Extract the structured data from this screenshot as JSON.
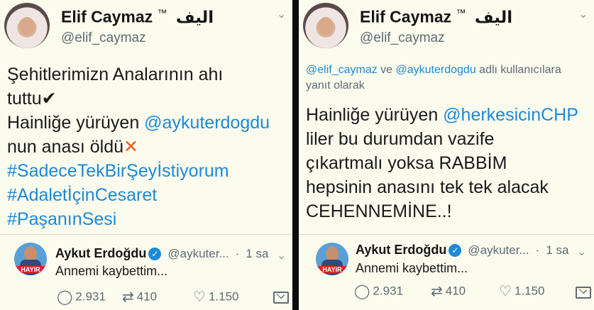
{
  "left": {
    "author": {
      "name": "Elif Caymaz",
      "tm": "™",
      "arabic": "اليف",
      "handle": "@elif_caymaz"
    },
    "lines": [
      {
        "text": "Şehitlerimizn Analarının ahı"
      },
      {
        "text": "tuttu",
        "suffix": "✔"
      },
      {
        "prefix": "Hainliğe yürüyen ",
        "mention": "@aykuterdogdu"
      },
      {
        "text": "nun anası öldü",
        "suffix": "✕"
      },
      {
        "hashtag": "#SadeceTekBirŞeyİstiyorum"
      },
      {
        "hashtag": "#AdaletİçinCesaret"
      },
      {
        "hashtag": "#PaşanınSesi"
      }
    ],
    "quote": {
      "name": "Aykut Erdoğdu",
      "verified": "✓",
      "handle": "@aykuter...",
      "dot": "·",
      "time": "1 sa",
      "text": "Annemi kaybettim...",
      "badge": "HAYIR"
    },
    "actions": {
      "replies": "2.931",
      "retweets": "410",
      "likes": "1.150"
    }
  },
  "right": {
    "author": {
      "name": "Elif Caymaz",
      "tm": "™",
      "arabic": "اليف",
      "handle": "@elif_caymaz"
    },
    "reply_to": {
      "mention1": "@elif_caymaz",
      "and": " ve ",
      "mention2": "@aykuterdogdu",
      "rest": " adlı kullanıcılara",
      "line2": "yanıt olarak"
    },
    "lines": [
      {
        "prefix": "Hainliğe yürüyen ",
        "mention": "@herkesicinCHP"
      },
      {
        "text": "liler bu durumdan vazife"
      },
      {
        "text": "çıkartmalı yoksa RABBİM"
      },
      {
        "text": "hepsinin anasını tek tek alacak"
      },
      {
        "text": "CEHENNEMİNE..!"
      }
    ],
    "quote": {
      "name": "Aykut Erdoğdu",
      "verified": "✓",
      "handle": "@aykuter...",
      "dot": "·",
      "time": "1 sa",
      "text": "Annemi kaybettim...",
      "badge": "HAYIR"
    },
    "actions": {
      "replies": "2.931",
      "retweets": "410",
      "likes": "1.150"
    }
  },
  "icons": {
    "reply": "reply-icon",
    "retweet": "retweet-icon",
    "like": "heart-icon",
    "dm": "mail-icon",
    "menu": "chevron-down-icon"
  },
  "colors": {
    "background": "#fbfbee",
    "link": "#1c8ad8",
    "muted": "#5e6b75",
    "verified": "#1c8ad8",
    "x_mark": "#e85c1c"
  }
}
